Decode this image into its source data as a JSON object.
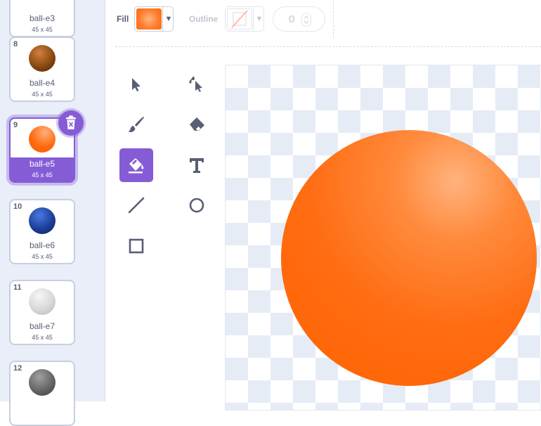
{
  "costumes": [
    {
      "number": "",
      "name": "ball-e3",
      "size": "45 x 45",
      "color": "#a0a0a0"
    },
    {
      "number": "8",
      "name": "ball-e4",
      "size": "45 x 45",
      "color": "#8a4a12"
    },
    {
      "number": "9",
      "name": "ball-e5",
      "size": "45 x 45",
      "color": "#ff6a10",
      "selected": true
    },
    {
      "number": "10",
      "name": "ball-e6",
      "size": "45 x 45",
      "color": "#1c3f9a"
    },
    {
      "number": "11",
      "name": "ball-e7",
      "size": "45 x 45",
      "color": "#d8d8d8"
    },
    {
      "number": "12",
      "name": "",
      "size": "",
      "color": "#666666"
    }
  ],
  "toolbar": {
    "fill_label": "Fill",
    "fill_color": "#ff7a2a",
    "outline_label": "Outline",
    "outline_width": "0"
  },
  "tools": [
    "select-tool",
    "reshape-tool",
    "brush-tool",
    "eraser-tool",
    "fill-tool",
    "text-tool",
    "line-tool",
    "circle-tool",
    "rectangle-tool"
  ],
  "colors": {
    "accent": "#855cd6",
    "text": "#575e75",
    "disabled": "#c3c6ce",
    "ball": "#ff6a10"
  }
}
